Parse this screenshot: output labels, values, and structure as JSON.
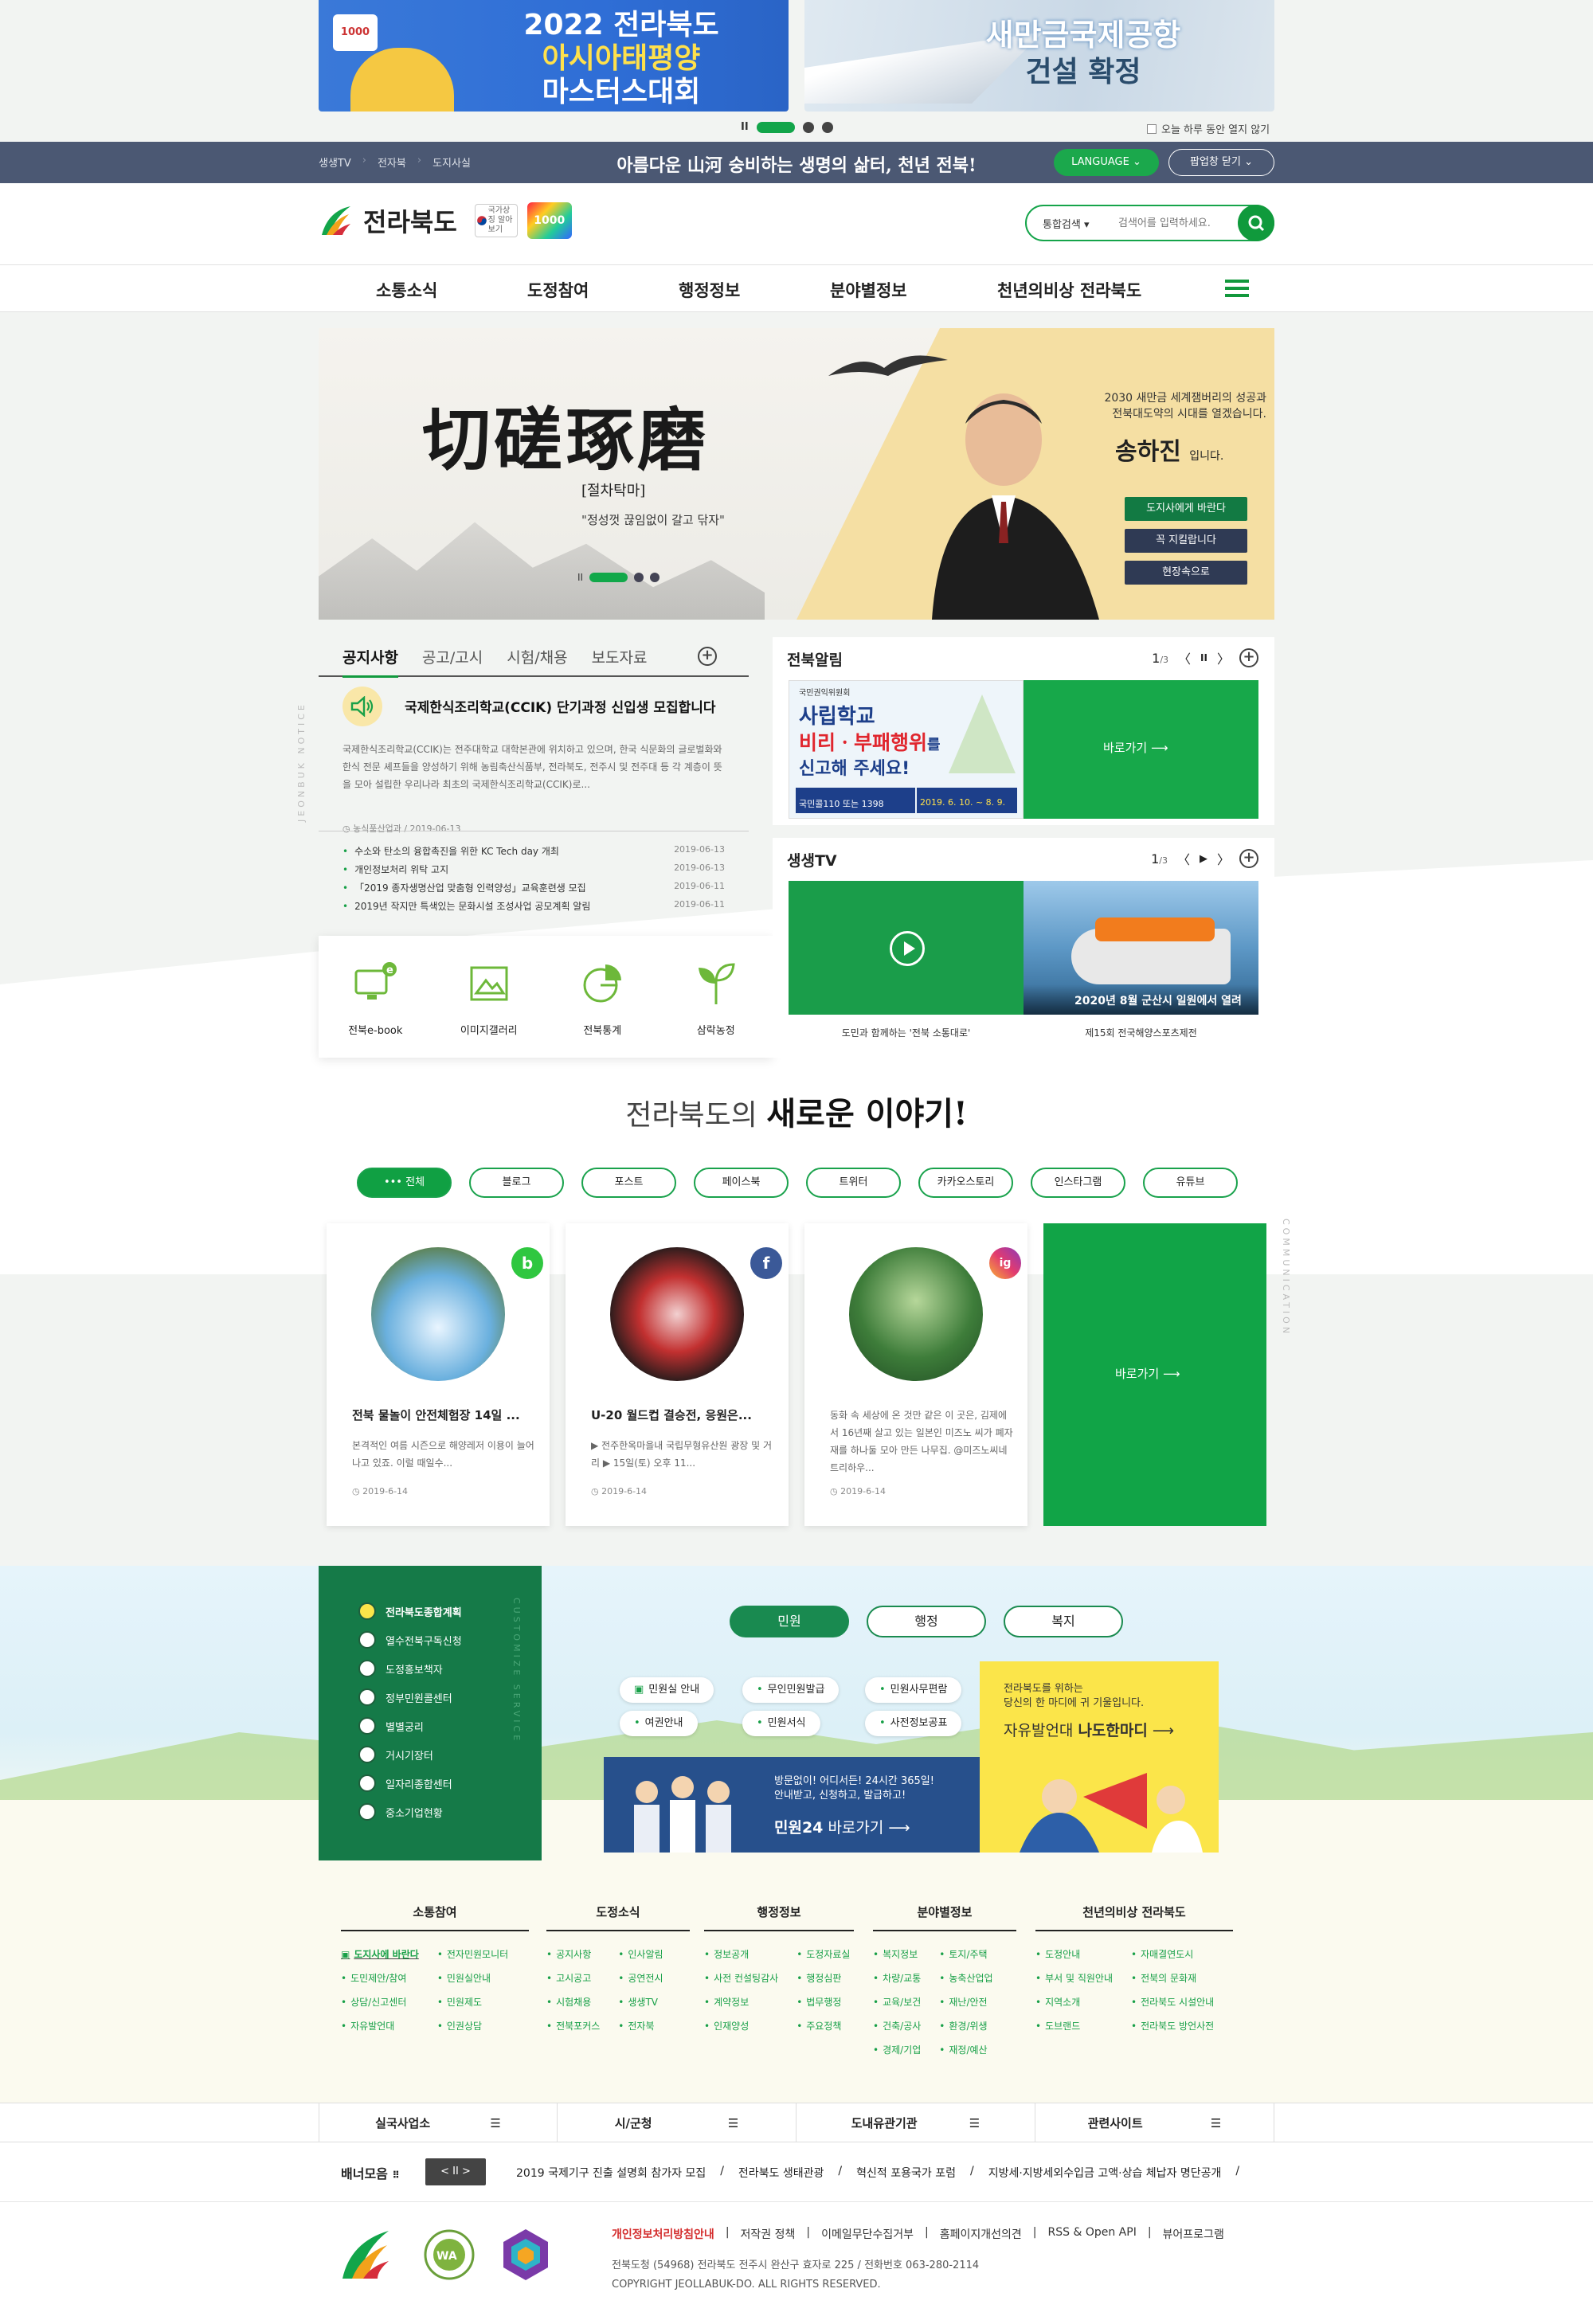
{
  "popups": {
    "left": {
      "line1": "2022 전라북도",
      "line2": "아시아태평양",
      "line3": "마스터스대회"
    },
    "right": {
      "line1": "새만금국제공항",
      "line2": "건설 확정"
    },
    "today_close": "오늘 하루 동안 열지 않기"
  },
  "topbar": {
    "links": [
      "생생TV",
      "전자북",
      "도지사실"
    ],
    "slogan": "아름다운 山河 숭비하는 생명의 삶터, 천년 전북!",
    "language": "LANGUAGE",
    "popup_close": "팝업창 닫기"
  },
  "header": {
    "logo_name": "전라북도",
    "flag_label": "국가상징 알아보기",
    "badge": "1000",
    "search_select": "통합검색",
    "search_placeholder": "검색어를 입력하세요."
  },
  "gnb": [
    "소통소식",
    "도정참여",
    "행정정보",
    "분야별정보",
    "천년의비상 전라북도"
  ],
  "hero": {
    "calligraphy": "切磋琢磨",
    "subtitle": "[절차탁마]",
    "quote": "\"정성껏 끊임없이 갈고 닦자\"",
    "message_line1": "2030 새만금 세계잼버리의 성공과",
    "message_line2": "전북대도약의 시대를 열겠습니다.",
    "signature": "송하진",
    "signature_suffix": "입니다.",
    "buttons": [
      "도지사에게 바란다",
      "꼭 지킬랍니다",
      "현장속으로"
    ]
  },
  "notice": {
    "vertical_label": "JEONBUK NOTICE",
    "tabs": [
      "공지사항",
      "공고/고시",
      "시험/채용",
      "보도자료"
    ],
    "headline": {
      "title": "국제한식조리학교(CCIK) 단기과정 신입생 모집합니다",
      "desc": "국제한식조리학교(CCIK)는 전주대학교 대학본관에 위치하고 있으며, 한국 식문화의 글로벌화와 한식 전문 셰프들을 양성하기 위해 농림축산식품부, 전라북도, 전주시 및 전주대 등 각 계층이 뜻을 모아 설립한 우리나라 최초의 국제한식조리학교(CCIK)로...",
      "meta": "농식품산업과 / 2019-06-13"
    },
    "list": [
      {
        "title": "수소와 탄소의 융합촉진을 위한 KC Tech day 개최",
        "date": "2019-06-13"
      },
      {
        "title": "개인정보처리 위탁 고지",
        "date": "2019-06-13"
      },
      {
        "title": "「2019 종자생명산업 맞춤형 인력양성」교육훈련생 모집",
        "date": "2019-06-11"
      },
      {
        "title": "2019년 작지만 특색있는 문화시설 조성사업 공모계획 알림",
        "date": "2019-06-11"
      }
    ]
  },
  "quick": [
    "전북e-book",
    "이미지갤러리",
    "전북통계",
    "삼락농정"
  ],
  "jeonbuk_alert": {
    "title": "전북알림",
    "page": "1",
    "total": "/3",
    "image_org": "국민권익위원회",
    "image_line1": "사립학교",
    "image_line2": "비리ㆍ부패행위",
    "image_line3": "를",
    "image_line4": "신고해 주세요!",
    "image_phone": "국민콜110 또는 1398",
    "image_period": "2019. 6. 10. ~ 8. 9.",
    "go": "바로가기"
  },
  "tv": {
    "title": "생생TV",
    "page": "1",
    "total": "/3",
    "items": [
      "도민과 함께하는 '전북 소통대로'",
      "제15회 전국해양스포츠제전"
    ],
    "video2_caption": "2020년 8월 군산시 일원에서 열려"
  },
  "stories": {
    "title_pre": "전라북도의",
    "title_em": "새로운 이야기!",
    "filters": [
      "전체",
      "블로그",
      "포스트",
      "페이스북",
      "트위터",
      "카카오스토리",
      "인스타그램",
      "유튜브"
    ],
    "cards": [
      {
        "badge": "b",
        "title": "전북 물놀이 안전체험장 14일 ...",
        "desc": "본격적인 여름 시즌으로 해양레저 이용이 늘어나고 있죠. 이럴 때일수...",
        "date": "2019-6-14"
      },
      {
        "badge": "f",
        "title": "U-20 월드컵 결승전, 응원은...",
        "desc": "▶ 전주한옥마을내 국립무형유산원 광장 및 거리 ▶ 15일(토) 오후 11...",
        "date": "2019-6-14"
      },
      {
        "badge": "ig",
        "title": "",
        "desc": "동화 속 세상에 온 것만 같은 이 곳은, 김제에서 16년째 살고 있는 일본인 미즈노 씨가 폐자재를 하나둘 모아 만든 나무집. @미즈노씨네 트리하우...",
        "date": "2019-6-14"
      }
    ],
    "go": "바로가기",
    "vertical_label": "COMMUNICATION"
  },
  "services": {
    "box": [
      "전라북도종합계획",
      "열수전북구독신청",
      "도정홍보책자",
      "정부민원콜센터",
      "별별궁리",
      "거시기장터",
      "일자리종합센터",
      "중소기업현황"
    ],
    "vertical_label": "CUSTOMIZE SERVICE",
    "tabs": [
      "민원",
      "행정",
      "복지"
    ],
    "pills": [
      "민원실 안내",
      "무인민원발급",
      "민원사무편람",
      "여권안내",
      "민원서식",
      "사전정보공표"
    ],
    "minwon_line1": "방문없이! 어디서든! 24시간 365일!",
    "minwon_line2": "안내받고, 신청하고, 발급하고!",
    "minwon_go_brand": "민원24",
    "minwon_go": "바로가기",
    "yellow_line1": "전라북도를 위하는",
    "yellow_line2": "당신의 한 마디에 귀 기울입니다.",
    "yellow_main": "자유발언대",
    "yellow_em": "나도한마디"
  },
  "footer_menu": [
    {
      "title": "소통참여",
      "items": [
        [
          "도지사에 바란다",
          "도민제안/참여",
          "상담/신고센터",
          "자유발언대"
        ],
        [
          "전자민원모니터",
          "민원실안내",
          "민원제도",
          "인권상담"
        ]
      ]
    },
    {
      "title": "도정소식",
      "items": [
        [
          "공지사항",
          "고시공고",
          "시험채용",
          "전북포커스"
        ],
        [
          "인사알림",
          "공연전시",
          "생생TV",
          "전자북"
        ]
      ]
    },
    {
      "title": "행정정보",
      "items": [
        [
          "정보공개",
          "사전 컨설팅감사",
          "계약정보",
          "인재양성"
        ],
        [
          "도정자료실",
          "행정심판",
          "법무행정",
          "주요정책"
        ]
      ]
    },
    {
      "title": "분야별정보",
      "items": [
        [
          "복지정보",
          "차량/교통",
          "교육/보건",
          "건축/공사",
          "경제/기업"
        ],
        [
          "토지/주택",
          "농축산업업",
          "재난/안전",
          "환경/위생",
          "재정/예산"
        ]
      ]
    },
    {
      "title": "천년의비상 전라북도",
      "items": [
        [
          "도정안내",
          "부서 및 직원안내",
          "지역소개",
          "도브랜드"
        ],
        [
          "자매결연도시",
          "전북의 문화재",
          "전라북도 시설안내",
          "전라북도 방언사전"
        ]
      ]
    }
  ],
  "sitebar": [
    "실국사업소",
    "시/군청",
    "도내유관기관",
    "관련사이트"
  ],
  "banners": {
    "label": "배너모음",
    "controls": "< II >",
    "items": [
      "2019 국제기구 진출 설명회 참가자 모집",
      "전라북도 생태관광",
      "혁신적 포용국가 포럼",
      "지방세·지방세외수입금 고액·상습 체납자 명단공개"
    ]
  },
  "footer": {
    "links": [
      "개인정보처리방침안내",
      "저작권 정책",
      "이메일무단수집거부",
      "홈페이지개선의견",
      "RSS & Open API",
      "뷰어프로그램"
    ],
    "address": "전북도청 (54968) 전라북도 전주시 완산구 효자로 225 / 전화번호 063-280-2114",
    "copyright": "COPYRIGHT JEOLLABUK-DO. ALL RIGHTS RESERVED."
  },
  "colors": {
    "brand_green": "#12a54a",
    "topbar": "#4b5873",
    "dark_green": "#157a48",
    "minwon_blue": "#27508c",
    "yellow": "#fbe54a"
  }
}
